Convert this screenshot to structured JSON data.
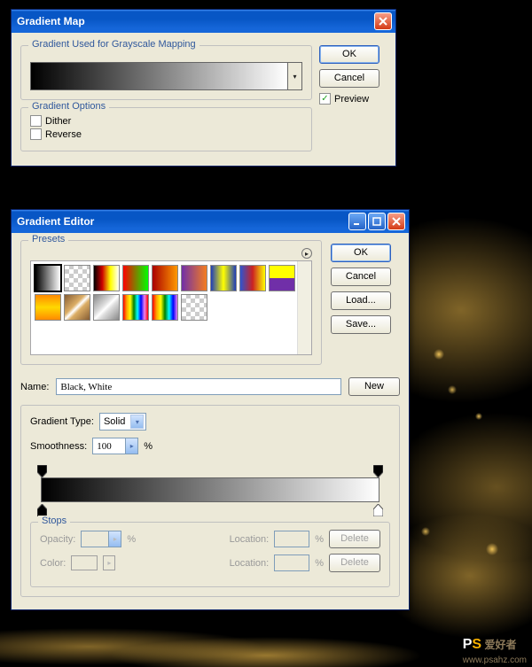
{
  "dlg_map": {
    "title": "Gradient Map",
    "group1_legend": "Gradient Used for Grayscale Mapping",
    "group2_legend": "Gradient Options",
    "dither_label": "Dither",
    "reverse_label": "Reverse",
    "ok": "OK",
    "cancel": "Cancel",
    "preview_label": "Preview",
    "preview_checked": true
  },
  "dlg_edit": {
    "title": "Gradient Editor",
    "presets_legend": "Presets",
    "ok": "OK",
    "cancel": "Cancel",
    "load": "Load...",
    "save": "Save...",
    "name_label": "Name:",
    "name_value": "Black, White",
    "new_label": "New",
    "gradient_type_label": "Gradient Type:",
    "gradient_type_value": "Solid",
    "smoothness_label": "Smoothness:",
    "smoothness_value": "100",
    "percent": "%",
    "stops_legend": "Stops",
    "opacity_label": "Opacity:",
    "location_label": "Location:",
    "color_label": "Color:",
    "delete_label": "Delete"
  },
  "watermark": {
    "text": "爱好者",
    "url": "www.psahz.com"
  },
  "chart_data": {
    "type": "gradient",
    "name": "Black, White",
    "gradient_type": "Solid",
    "smoothness_percent": 100,
    "color_stops": [
      {
        "location_percent": 0,
        "color": "#000000"
      },
      {
        "location_percent": 100,
        "color": "#ffffff"
      }
    ],
    "opacity_stops": [
      {
        "location_percent": 0,
        "opacity_percent": 100
      },
      {
        "location_percent": 100,
        "opacity_percent": 100
      }
    ],
    "presets": [
      "linear-gradient(to right,#000,#fff)",
      "repeating-conic-gradient(#ccc 0 25%,#fff 0 50%) 0/10px 10px, linear-gradient(to right,#72b850,transparent)",
      "linear-gradient(to right,#000,#c00,#ff0,#fff)",
      "linear-gradient(to right,#f00,#0f0)",
      "linear-gradient(to right,#a00,#f90)",
      "linear-gradient(to right,#702fa8,#f47d20)",
      "linear-gradient(to right,#1e3cb8,#ff0,#1e3cb8)",
      "linear-gradient(to right,#2e54d0,#c22,#ff0)",
      "linear-gradient(to bottom,#ff0 50%,#702fa8 50%)",
      "linear-gradient(to bottom,#ff8a00,#ffd800 50%,#ff8a00)",
      "linear-gradient(135deg,#855c33,#dcae66 40%,#fff 50%,#dcae66 60%,#855c33)",
      "linear-gradient(135deg,#888,#ddd 40%,#fff 50%,#ddd 60%,#888)",
      "linear-gradient(to right,red,orange,yellow,green,cyan,blue,violet,red)",
      "linear-gradient(to right,red,orange,yellow,green,cyan,blue,violet)",
      "repeating-conic-gradient(#ccc 0 25%,#fff 0 50%) 0/10px 10px"
    ]
  }
}
